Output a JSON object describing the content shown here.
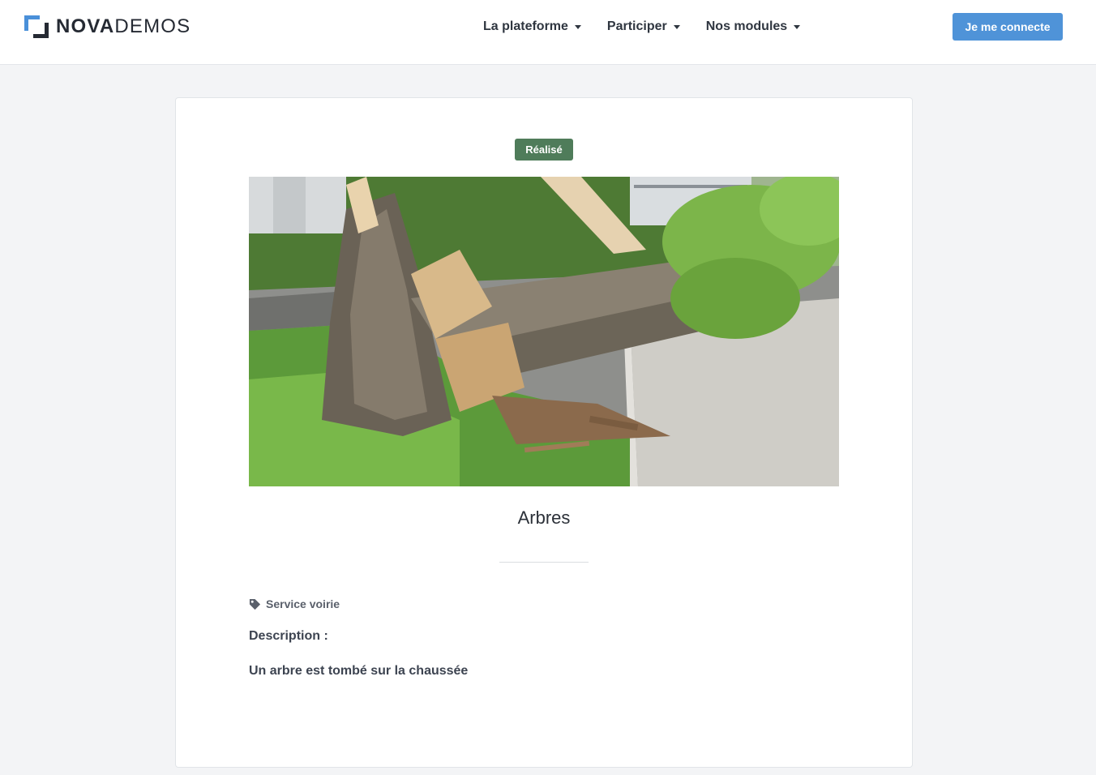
{
  "header": {
    "logo": {
      "bold": "NOVA",
      "light": "DEMOS"
    },
    "nav": [
      {
        "label": "La plateforme"
      },
      {
        "label": "Participer"
      },
      {
        "label": "Nos modules"
      }
    ],
    "login_label": "Je me connecte"
  },
  "card": {
    "status_badge": "Réalisé",
    "title": "Arbres",
    "service": "Service voirie",
    "description_heading": "Description :",
    "description_text": "Un arbre est tombé sur la chaussée"
  },
  "colors": {
    "accent": "#4f93d8",
    "status_done": "#4f7c5a",
    "background": "#f3f4f6"
  },
  "icons": {
    "nav_caret": "chevron-down-icon",
    "service": "tag-icon"
  }
}
